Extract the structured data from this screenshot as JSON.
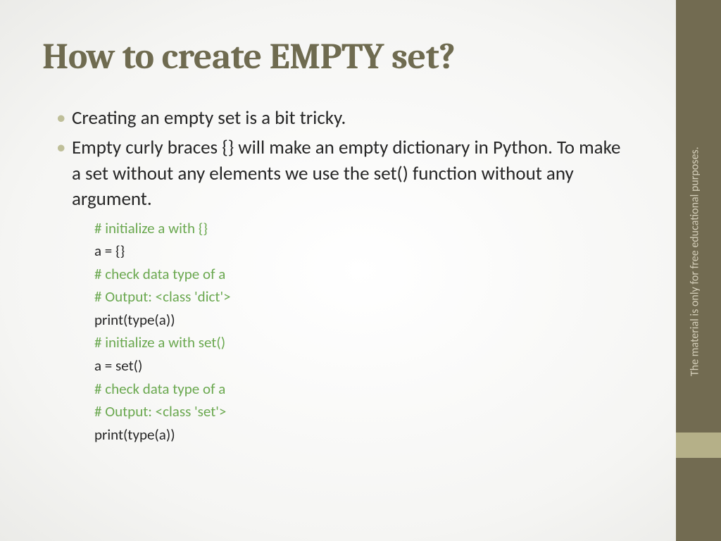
{
  "title": "How to create EMPTY set?",
  "bullets": [
    "Creating an empty set is a bit tricky.",
    "Empty curly braces {} will make an empty dictionary in Python. To make a set without any elements we use the set() function without any argument."
  ],
  "code": [
    {
      "text": "# initialize a with {}",
      "kind": "comment"
    },
    {
      "text": "a = {}",
      "kind": "code"
    },
    {
      "text": "# check data type of a",
      "kind": "comment"
    },
    {
      "text": "# Output: <class 'dict'>",
      "kind": "comment"
    },
    {
      "text": "print(type(a))",
      "kind": "code"
    },
    {
      "text": "# initialize a with set()",
      "kind": "comment"
    },
    {
      "text": "a = set()",
      "kind": "code"
    },
    {
      "text": "# check data type of a",
      "kind": "comment"
    },
    {
      "text": "# Output: <class 'set'>",
      "kind": "comment"
    },
    {
      "text": "print(type(a))",
      "kind": "code"
    }
  ],
  "sidebar_text": "The material is only for free educational purposes."
}
